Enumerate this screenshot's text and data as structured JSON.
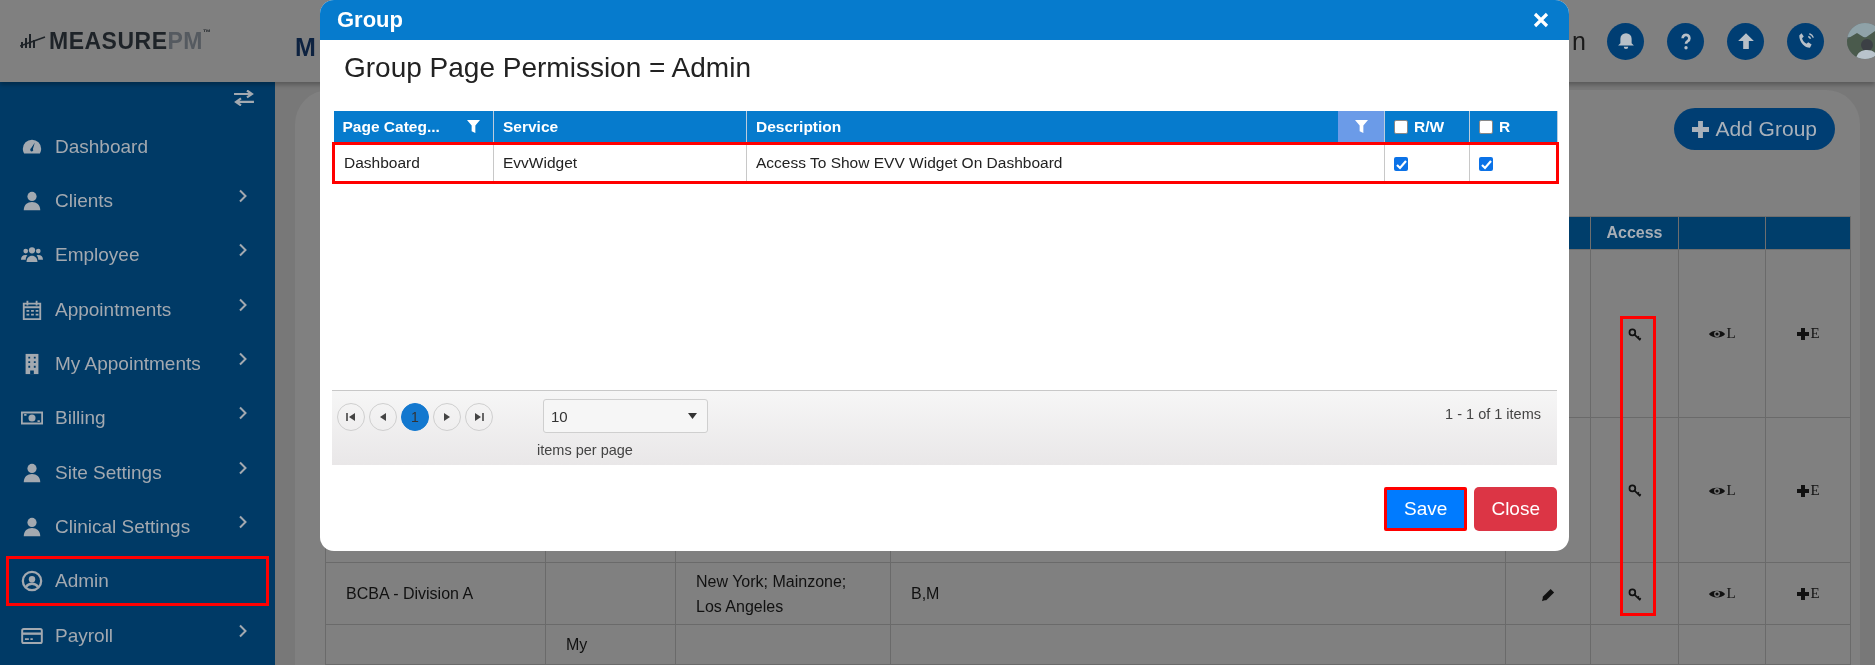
{
  "header": {
    "logo": {
      "primary": "MEASURE",
      "secondary": "PM",
      "mark": "™"
    },
    "partial_logo": "M",
    "user_name_fragment": "n"
  },
  "sidebar": {
    "items": [
      {
        "label": "Dashboard",
        "has_submenu": false,
        "highlighted": false
      },
      {
        "label": "Clients",
        "has_submenu": true,
        "highlighted": false
      },
      {
        "label": "Employee",
        "has_submenu": true,
        "highlighted": false
      },
      {
        "label": "Appointments",
        "has_submenu": true,
        "highlighted": false
      },
      {
        "label": "My Appointments",
        "has_submenu": true,
        "highlighted": false
      },
      {
        "label": "Billing",
        "has_submenu": true,
        "highlighted": false
      },
      {
        "label": "Site Settings",
        "has_submenu": true,
        "highlighted": false
      },
      {
        "label": "Clinical Settings",
        "has_submenu": true,
        "highlighted": false
      },
      {
        "label": "Admin",
        "has_submenu": false,
        "highlighted": true
      },
      {
        "label": "Payroll",
        "has_submenu": true,
        "highlighted": false
      }
    ]
  },
  "page": {
    "add_button": "Add Group",
    "table": {
      "access_header": "Access",
      "access_frame": true,
      "rows": [
        {
          "edit": false,
          "access": true,
          "view_label": "L",
          "add_label": "E"
        },
        {
          "edit": false,
          "access": true,
          "view_label": "L",
          "add_label": "E"
        },
        {
          "name": "BCBA - Division A",
          "locations": "New York; Mainzone; Los Angeles",
          "codes": "B,M",
          "edit": true,
          "access": true,
          "view_label": "L",
          "add_label": "E"
        },
        {
          "column_2": "My",
          "edit": false,
          "access": false
        }
      ]
    }
  },
  "modal": {
    "title": "Group",
    "heading": "Group Page Permission = Admin",
    "grid": {
      "columns": [
        {
          "kind": "text",
          "label": "Page Categ...",
          "filter": true,
          "filtered": false
        },
        {
          "kind": "text",
          "label": "Service",
          "filter": false
        },
        {
          "kind": "text",
          "label": "Description",
          "filter": true,
          "filtered": true
        },
        {
          "kind": "checkbox",
          "label": "R/W",
          "checked": false
        },
        {
          "kind": "checkbox",
          "label": "R",
          "checked": false
        }
      ],
      "rows": [
        {
          "page_category": "Dashboard",
          "service": "EvvWidget",
          "description": "Access To Show EVV Widget On Dashboard",
          "read_write": true,
          "read": true,
          "highlighted": true
        }
      ]
    },
    "pager": {
      "pages": [
        {
          "label": "1",
          "selected": true
        }
      ],
      "page_size": "10",
      "page_size_label": "items per page",
      "summary": "1 - 1 of 1 items"
    },
    "buttons": [
      {
        "label": "Save",
        "kind": "primary",
        "highlighted": true
      },
      {
        "label": "Close",
        "kind": "danger",
        "highlighted": false
      }
    ]
  }
}
